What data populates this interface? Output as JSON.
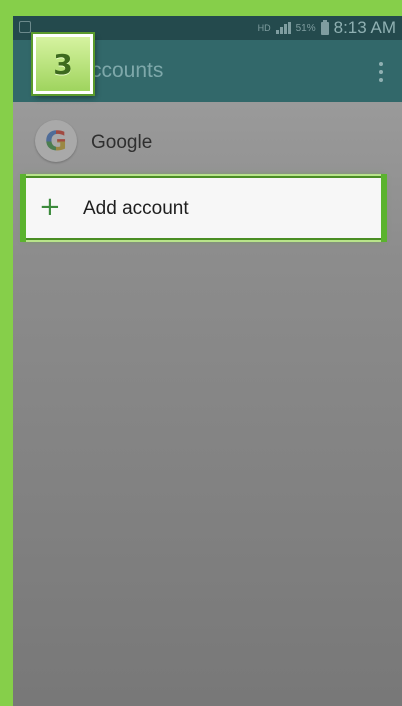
{
  "status_bar": {
    "network": "HD",
    "battery_percent": "51%",
    "time": "8:13 AM",
    "signal_icon": "signal-bars-icon",
    "battery_icon": "battery-icon"
  },
  "toolbar": {
    "title": "ccounts",
    "menu_icon": "overflow-menu-icon"
  },
  "accounts": {
    "google": {
      "icon_letter": "G",
      "label": "Google"
    },
    "add": {
      "icon": "+",
      "label": "Add account"
    }
  },
  "overlay": {
    "step_number": "3"
  },
  "colors": {
    "frame": "#86cf4a",
    "toolbar": "#32686a",
    "status_bar": "#244a4d",
    "highlight": "#5bb32e"
  }
}
